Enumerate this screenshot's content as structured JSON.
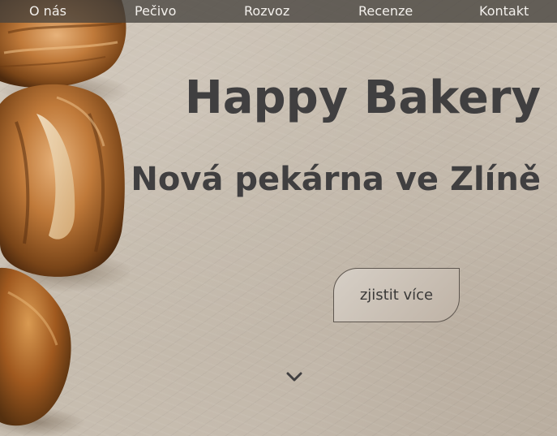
{
  "nav": {
    "items": [
      {
        "label": "O nás"
      },
      {
        "label": "Pečivo"
      },
      {
        "label": "Rozvoz"
      },
      {
        "label": "Recenze"
      },
      {
        "label": "Kontakt"
      }
    ]
  },
  "hero": {
    "title": "Happy Bakery",
    "subtitle": "Nová pekárna ve Zlíně",
    "cta_label": "zjistit více",
    "scroll_icon": "chevron-down-icon"
  },
  "colors": {
    "text": "#403f40",
    "nav_bg": "#46423e",
    "nav_text": "#f3f0ec",
    "background": "#c9bfb2"
  }
}
